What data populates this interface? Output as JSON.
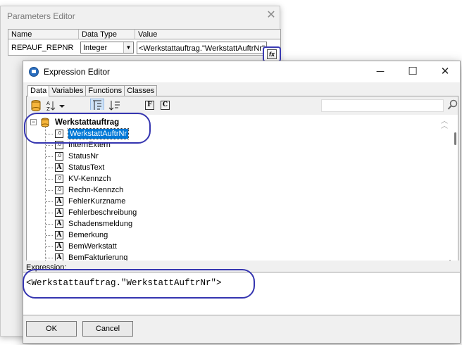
{
  "params_editor": {
    "title": "Parameters Editor",
    "columns": [
      "Name",
      "Data Type",
      "Value"
    ],
    "row": {
      "name": "REPAUF_REPNR",
      "data_type": "Integer",
      "value": "<Werkstattauftrag.\"WerkstattAuftrNr\">"
    },
    "fx_label": "fx"
  },
  "expression_editor": {
    "title": "Expression Editor",
    "tabs": [
      "Data",
      "Variables",
      "Functions",
      "Classes"
    ],
    "active_tab": "Data",
    "toolbar": {
      "sort_label": "A Z",
      "f_label": "F",
      "c_label": "C"
    },
    "tree": {
      "root": "Werkstattauftrag",
      "items": [
        {
          "label": "WerkstattAuftrNr",
          "type": "numeric",
          "icon_text": ".0",
          "selected": true
        },
        {
          "label": "InternExtern",
          "type": "numeric",
          "icon_text": ".0"
        },
        {
          "label": "StatusNr",
          "type": "numeric",
          "icon_text": ".0"
        },
        {
          "label": "StatusText",
          "type": "text",
          "icon_text": "A"
        },
        {
          "label": "KV-Kennzch",
          "type": "numeric",
          "icon_text": ".0"
        },
        {
          "label": "Rechn-Kennzch",
          "type": "numeric",
          "icon_text": ".0"
        },
        {
          "label": "FehlerKurzname",
          "type": "text",
          "icon_text": "A"
        },
        {
          "label": "Fehlerbeschreibung",
          "type": "text",
          "icon_text": "A"
        },
        {
          "label": "Schadensmeldung",
          "type": "text",
          "icon_text": "A"
        },
        {
          "label": "Bemerkung",
          "type": "text",
          "icon_text": "A"
        },
        {
          "label": "BemWerkstatt",
          "type": "text",
          "icon_text": "A"
        },
        {
          "label": "BemFakturierung",
          "type": "text",
          "icon_text": "A"
        }
      ]
    },
    "expression_label": "Expression:",
    "expression_value": "<Werkstattauftrag.\"WerkstattAuftrNr\">",
    "ok_label": "OK",
    "cancel_label": "Cancel"
  },
  "colors": {
    "annotation": "#3535b0",
    "selection": "#0078d7"
  }
}
